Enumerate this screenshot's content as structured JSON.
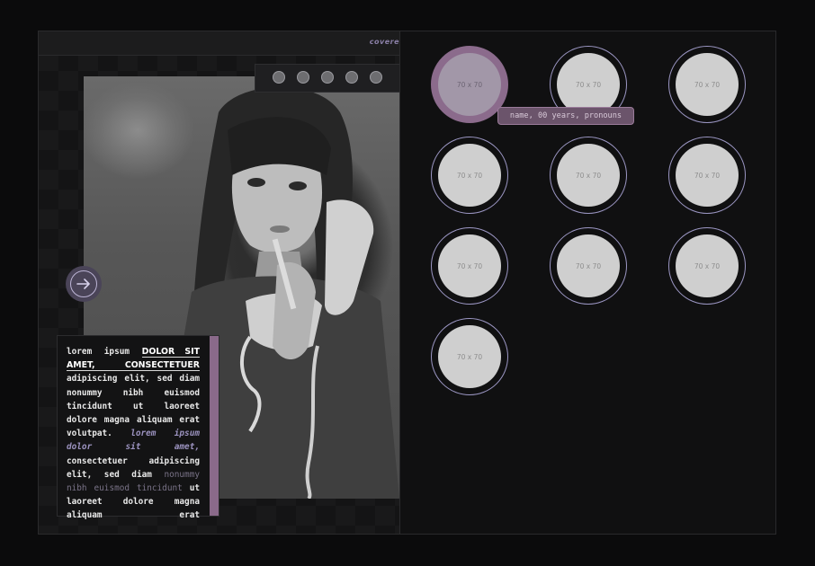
{
  "topbar": {
    "title": "covere"
  },
  "dots": {
    "count": 5
  },
  "text_card": {
    "intro": "lorem ipsum",
    "heading": "DOLOR SIT AMET, CONSECTETUER",
    "para1": "adipiscing elit, sed diam nonummy nibh euismod tincidunt ut laoreet dolore magna aliquam erat volutpat.",
    "emphasis": "lorem ipsum dolor sit amet,",
    "para2": "consectetuer adipiscing elit, sed diam",
    "muted": "nonummy nibh euismod tincidunt",
    "para3": "ut laoreet dolore magna aliquam erat"
  },
  "avatars": [
    {
      "label": "70 x 70",
      "active": true
    },
    {
      "label": "70 x 70",
      "active": false
    },
    {
      "label": "70 x 70",
      "active": false
    },
    {
      "label": "70 x 70",
      "active": false
    },
    {
      "label": "70 x 70",
      "active": false
    },
    {
      "label": "70 x 70",
      "active": false
    },
    {
      "label": "70 x 70",
      "active": false
    },
    {
      "label": "70 x 70",
      "active": false
    },
    {
      "label": "70 x 70",
      "active": false
    },
    {
      "label": "70 x 70",
      "active": false
    }
  ],
  "tooltip": {
    "text": "name, 00 years, pronouns"
  },
  "colors": {
    "accent": "#8b6b8c",
    "ring": "#9c97c4",
    "emphasis": "#9c93c0"
  },
  "icons": {
    "next": "arrow-right-icon"
  }
}
